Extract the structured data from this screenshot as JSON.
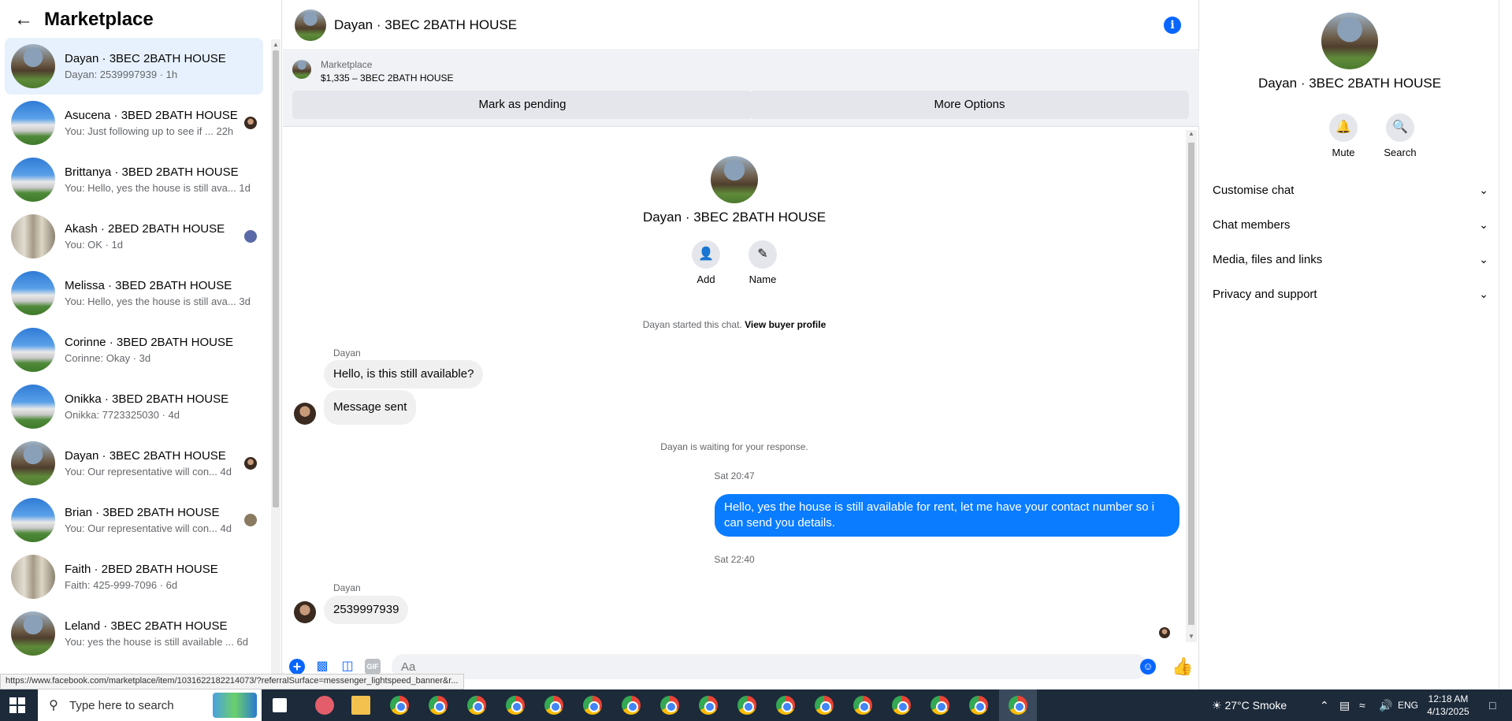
{
  "sidebar": {
    "title": "Marketplace",
    "conversations": [
      {
        "title": "Dayan · 3BEC 2BATH HOUSE",
        "sub": "Dayan: 2539997939 · 1h"
      },
      {
        "title": "Asucena · 3BED 2BATH HOUSE",
        "sub": "You: Just following up to see if ... 22h"
      },
      {
        "title": "Brittanya · 3BED 2BATH HOUSE",
        "sub": "You: Hello, yes the house is still ava... 1d"
      },
      {
        "title": "Akash · 2BED 2BATH HOUSE",
        "sub": "You: OK · 1d"
      },
      {
        "title": "Melissa · 3BED 2BATH HOUSE",
        "sub": "You: Hello, yes the house is still ava... 3d"
      },
      {
        "title": "Corinne · 3BED 2BATH HOUSE",
        "sub": "Corinne: Okay · 3d"
      },
      {
        "title": "Onikka · 3BED 2BATH HOUSE",
        "sub": "Onikka: 7723325030 · 4d"
      },
      {
        "title": "Dayan · 3BEC 2BATH HOUSE",
        "sub": "You: Our representative will con... 4d"
      },
      {
        "title": "Brian · 3BED 2BATH HOUSE",
        "sub": "You: Our representative will con... 4d"
      },
      {
        "title": "Faith · 2BED 2BATH HOUSE",
        "sub": "Faith: 425-999-7096 · 6d"
      },
      {
        "title": "Leland · 3BEC 2BATH HOUSE",
        "sub": "You: yes the house is still available ... 6d"
      }
    ]
  },
  "chat": {
    "header_name": "Dayan · 3BEC 2BATH HOUSE",
    "marketplace_label": "Marketplace",
    "listing": "$1,335 – 3BEC 2BATH HOUSE",
    "mark_pending": "Mark as pending",
    "more_options": "More Options",
    "profile_name": "Dayan · 3BEC 2BATH HOUSE",
    "add_label": "Add",
    "name_label": "Name",
    "started_text": "Dayan started this chat.",
    "view_profile": "View buyer profile",
    "sender1": "Dayan",
    "msg1": "Hello, is this still available?",
    "msg2": "Message sent",
    "waiting": "Dayan is waiting for your response.",
    "time1": "Sat 20:47",
    "out_msg": "Hello, yes the house is still available for rent, let me have your contact number so i can send you details.",
    "time2": "Sat 22:40",
    "sender2": "Dayan",
    "msg3": "2539997939",
    "composer_placeholder": "Aa",
    "gif_label": "GIF"
  },
  "right_panel": {
    "name": "Dayan · 3BEC 2BATH HOUSE",
    "mute": "Mute",
    "search": "Search",
    "sections": [
      "Customise chat",
      "Chat members",
      "Media, files and links",
      "Privacy and support"
    ]
  },
  "status_url": "https://www.facebook.com/marketplace/item/1031622182214073/?referralSurface=messenger_lightspeed_banner&r...",
  "taskbar": {
    "search_placeholder": "Type here to search",
    "weather": "27°C  Smoke",
    "lang": "ENG",
    "time": "12:18 AM",
    "date": "4/13/2025"
  }
}
